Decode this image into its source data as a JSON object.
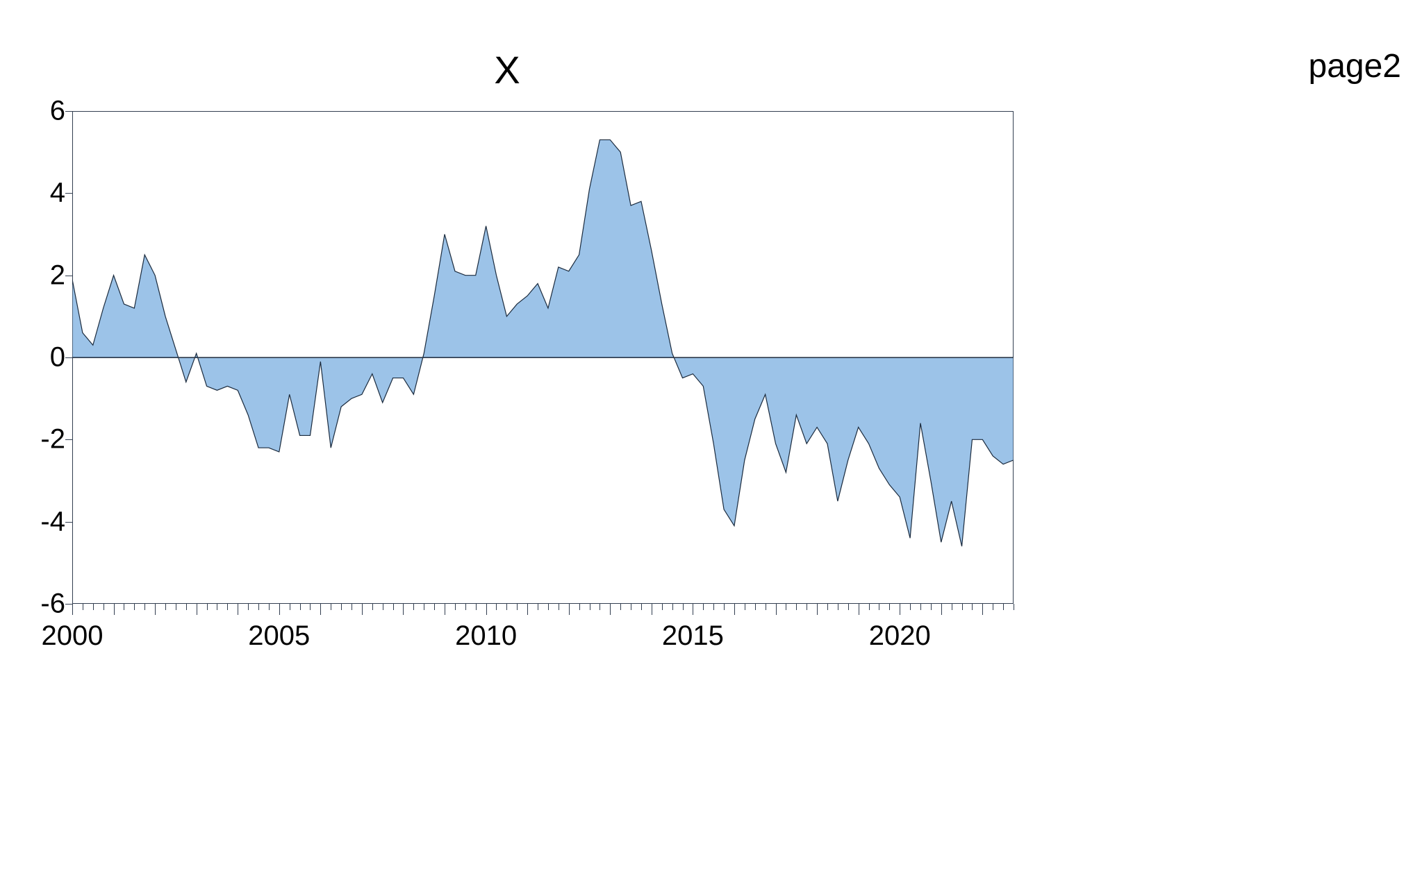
{
  "chart_data": {
    "type": "area",
    "title": "X",
    "page_label": "page2",
    "xlabel": "",
    "ylabel": "",
    "xlim": [
      2000,
      2022.75
    ],
    "ylim": [
      -6,
      6
    ],
    "x_major_ticks": [
      2000,
      2005,
      2010,
      2015,
      2020
    ],
    "x_minor_ticks_per_major": 4,
    "y_ticks": [
      -6,
      -4,
      -2,
      0,
      2,
      4,
      6
    ],
    "x": [
      2000.0,
      2000.25,
      2000.5,
      2000.75,
      2001.0,
      2001.25,
      2001.5,
      2001.75,
      2002.0,
      2002.25,
      2002.5,
      2002.75,
      2003.0,
      2003.25,
      2003.5,
      2003.75,
      2004.0,
      2004.25,
      2004.5,
      2004.75,
      2005.0,
      2005.25,
      2005.5,
      2005.75,
      2006.0,
      2006.25,
      2006.5,
      2006.75,
      2007.0,
      2007.25,
      2007.5,
      2007.75,
      2008.0,
      2008.25,
      2008.5,
      2008.75,
      2009.0,
      2009.25,
      2009.5,
      2009.75,
      2010.0,
      2010.25,
      2010.5,
      2010.75,
      2011.0,
      2011.25,
      2011.5,
      2011.75,
      2012.0,
      2012.25,
      2012.5,
      2012.75,
      2013.0,
      2013.25,
      2013.5,
      2013.75,
      2014.0,
      2014.25,
      2014.5,
      2014.75,
      2015.0,
      2015.25,
      2015.5,
      2015.75,
      2016.0,
      2016.25,
      2016.5,
      2016.75,
      2017.0,
      2017.25,
      2017.5,
      2017.75,
      2018.0,
      2018.25,
      2018.5,
      2018.75,
      2019.0,
      2019.25,
      2019.5,
      2019.75,
      2020.0,
      2020.25,
      2020.5,
      2020.75,
      2021.0,
      2021.25,
      2021.5,
      2021.75,
      2022.0,
      2022.25,
      2022.5,
      2022.75
    ],
    "values": [
      1.9,
      0.6,
      0.3,
      1.2,
      2.0,
      1.3,
      1.2,
      2.5,
      2.0,
      1.0,
      0.2,
      -0.6,
      0.1,
      -0.7,
      -0.8,
      -0.7,
      -0.8,
      -1.4,
      -2.2,
      -2.2,
      -2.3,
      -0.9,
      -1.9,
      -1.9,
      -0.1,
      -2.2,
      -1.2,
      -1.0,
      -0.9,
      -0.4,
      -1.1,
      -0.5,
      -0.5,
      -0.9,
      0.1,
      1.5,
      3.0,
      2.1,
      2.0,
      2.0,
      3.2,
      2.0,
      1.0,
      1.3,
      1.5,
      1.8,
      1.2,
      2.2,
      2.1,
      2.5,
      4.1,
      5.3,
      5.3,
      5.0,
      3.7,
      3.8,
      2.6,
      1.3,
      0.1,
      -0.5,
      -0.4,
      -0.7,
      -2.1,
      -3.7,
      -4.1,
      -2.5,
      -1.5,
      -0.9,
      -2.1,
      -2.8,
      -1.4,
      -2.1,
      -1.7,
      -2.1,
      -3.5,
      -2.5,
      -1.7,
      -2.1,
      -2.7,
      -3.1,
      -3.4,
      -4.4,
      -1.6,
      -3.0,
      -4.5,
      -3.5,
      -4.6,
      -2.0,
      -2.0,
      -2.4,
      -2.6,
      -2.5
    ],
    "fill_color": "#9cc3e8",
    "line_color": "#1a2a3d"
  }
}
